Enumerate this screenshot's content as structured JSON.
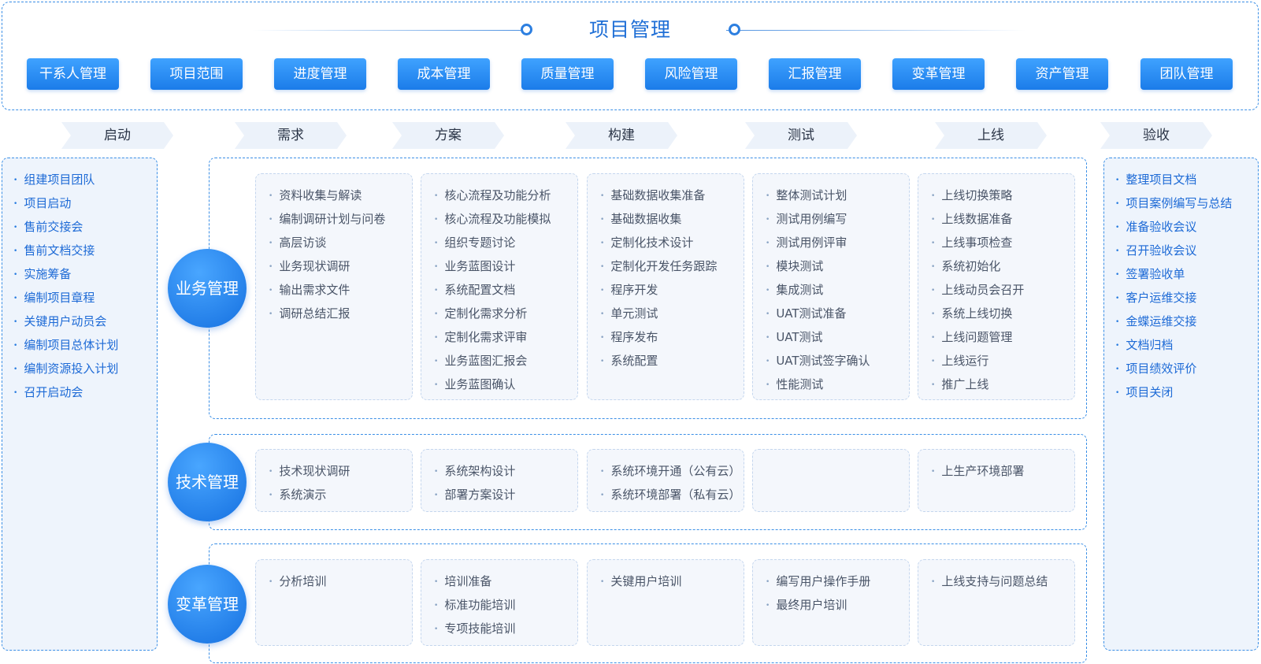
{
  "title": "项目管理",
  "modules": [
    "干系人管理",
    "项目范围",
    "进度管理",
    "成本管理",
    "质量管理",
    "风险管理",
    "汇报管理",
    "变革管理",
    "资产管理",
    "团队管理"
  ],
  "phases": [
    "启动",
    "需求",
    "方案",
    "构建",
    "测试",
    "上线",
    "验收"
  ],
  "start_items": [
    "组建项目团队",
    "项目启动",
    "售前交接会",
    "售前文档交接",
    "实施筹备",
    "编制项目章程",
    "关键用户动员会",
    "编制项目总体计划",
    "编制资源投入计划",
    "召开启动会"
  ],
  "accept_items": [
    "整理项目文档",
    "项目案例编写与总结",
    "准备验收会议",
    "召开验收会议",
    "签署验收单",
    "客户运维交接",
    "金蝶运维交接",
    "文档归档",
    "项目绩效评价",
    "项目关闭"
  ],
  "rows": [
    {
      "label": "业务管理",
      "cells": [
        [
          "资料收集与解读",
          "编制调研计划与问卷",
          "高层访谈",
          "业务现状调研",
          "输出需求文件",
          "调研总结汇报"
        ],
        [
          "核心流程及功能分析",
          "核心流程及功能模拟",
          "组织专题讨论",
          "业务蓝图设计",
          "系统配置文档",
          "定制化需求分析",
          "定制化需求评审",
          "业务蓝图汇报会",
          "业务蓝图确认"
        ],
        [
          "基础数据收集准备",
          "基础数据收集",
          "定制化技术设计",
          "定制化开发任务跟踪",
          "程序开发",
          "单元测试",
          "程序发布",
          "系统配置"
        ],
        [
          "整体测试计划",
          "测试用例编写",
          "测试用例评审",
          "模块测试",
          "集成测试",
          "UAT测试准备",
          "UAT测试",
          "UAT测试签字确认",
          "性能测试"
        ],
        [
          "上线切换策略",
          "上线数据准备",
          "上线事项检查",
          "系统初始化",
          "上线动员会召开",
          "系统上线切换",
          "上线问题管理",
          "上线运行",
          "推广上线"
        ]
      ]
    },
    {
      "label": "技术管理",
      "cells": [
        [
          "技术现状调研",
          "系统演示"
        ],
        [
          "系统架构设计",
          "部署方案设计"
        ],
        [
          "系统环境开通（公有云）",
          "系统环境部署（私有云）"
        ],
        [],
        [
          "上生产环境部署"
        ]
      ]
    },
    {
      "label": "变革管理",
      "cells": [
        [
          "分析培训"
        ],
        [
          "培训准备",
          "标准功能培训",
          "专项技能培训"
        ],
        [
          "关键用户培训"
        ],
        [
          "编写用户操作手册",
          "最终用户培训"
        ],
        [
          "上线支持与问题总结"
        ]
      ]
    }
  ]
}
